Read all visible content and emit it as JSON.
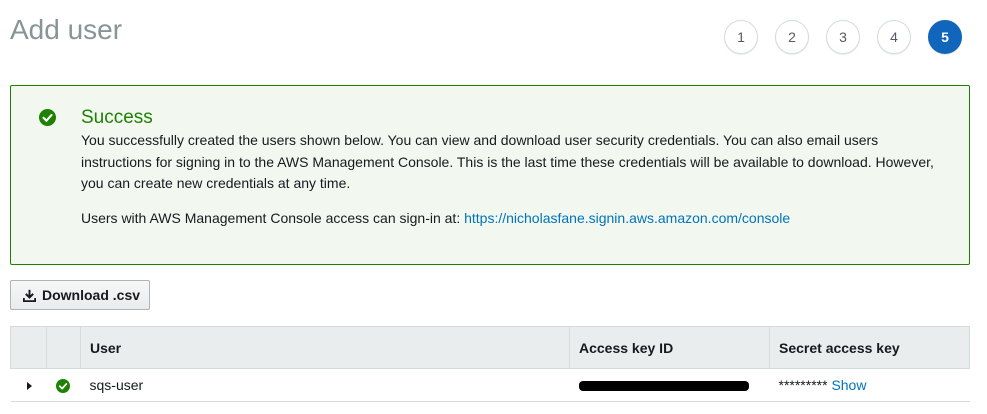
{
  "page": {
    "title": "Add user"
  },
  "steps": [
    "1",
    "2",
    "3",
    "4",
    "5"
  ],
  "active_step": "5",
  "success": {
    "title": "Success",
    "message": "You successfully created the users shown below. You can view and download user security credentials. You can also email users instructions for signing in to the AWS Management Console. This is the last time these credentials will be available to download. However, you can create new credentials at any time.",
    "signin_prefix": "Users with AWS Management Console access can sign-in at: ",
    "signin_url": "https://nicholasfane.signin.aws.amazon.com/console"
  },
  "toolbar": {
    "download_label": "Download .csv"
  },
  "table": {
    "headers": {
      "user": "User",
      "access_key": "Access key ID",
      "secret_key": "Secret access key"
    },
    "rows": [
      {
        "user": "sqs-user",
        "secret_masked": "*********",
        "show_label": "Show"
      }
    ]
  },
  "colors": {
    "success_green": "#1d8102",
    "step_active": "#1166bb",
    "link_blue": "#0073bb"
  },
  "icons": {
    "success": "check-circle-icon",
    "download": "download-icon",
    "expand": "caret-right-icon",
    "row_status": "check-circle-icon"
  }
}
